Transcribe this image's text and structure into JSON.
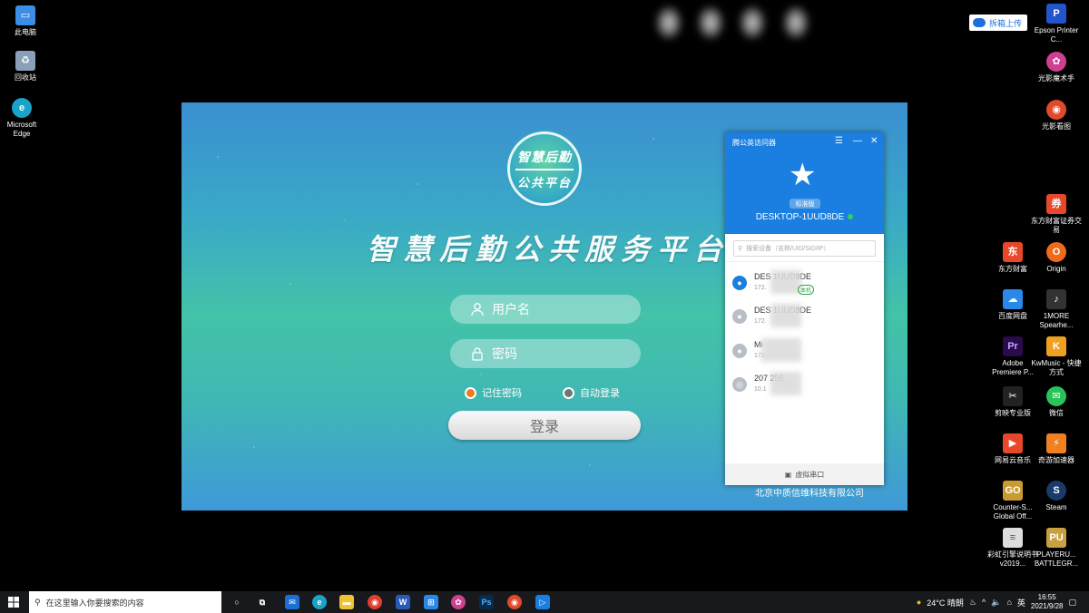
{
  "desktop_left": [
    {
      "label": "此电脑",
      "icon": "computer-icon",
      "color": "#3a8ee6"
    },
    {
      "label": "回收站",
      "icon": "recycle-bin-icon",
      "color": "#8aa0b8"
    },
    {
      "label": "Microsoft Edge",
      "icon": "edge-icon",
      "color": "#19a3c8"
    }
  ],
  "desktop_right": [
    {
      "label": "Epson Printer C...",
      "icon": "printer-icon",
      "color": "#2255cc"
    },
    {
      "label": "光影魔术手",
      "icon": "photo-editor-icon",
      "color": "#d04090"
    },
    {
      "label": "光影看图",
      "icon": "image-viewer-icon",
      "color": "#e04a2a"
    },
    {
      "label": "东方财富证券交易",
      "icon": "stock-trading-icon",
      "color": "#e8482a"
    },
    {
      "label": "东方财富",
      "icon": "eastmoney-icon",
      "color": "#e8482a"
    },
    {
      "label": "Origin",
      "icon": "origin-icon",
      "color": "#f06a1a"
    },
    {
      "label": "百度网盘",
      "icon": "baidu-netdisk-icon",
      "color": "#2a88e8"
    },
    {
      "label": "1MORE Spearhe...",
      "icon": "headphone-icon",
      "color": "#333333"
    },
    {
      "label": "Adobe Premiere P...",
      "icon": "premiere-icon",
      "color": "#2a0a4a"
    },
    {
      "label": "KwMusic - 快捷方式",
      "icon": "kwmusic-icon",
      "color": "#f0a020"
    },
    {
      "label": "剪映专业版",
      "icon": "jianying-icon",
      "color": "#222222"
    },
    {
      "label": "微信",
      "icon": "wechat-icon",
      "color": "#2ac35a"
    },
    {
      "label": "网易云音乐",
      "icon": "netease-music-icon",
      "color": "#e8482a"
    },
    {
      "label": "奇游加速器",
      "icon": "accelerator-icon",
      "color": "#f08020"
    },
    {
      "label": "Counter-S... Global Off...",
      "icon": "csgo-icon",
      "color": "#c89a30"
    },
    {
      "label": "Steam",
      "icon": "steam-icon",
      "color": "#1a3a6a"
    },
    {
      "label": "彩虹引擎说明书 v2019...",
      "icon": "document-icon",
      "color": "#dddddd"
    },
    {
      "label": "PLAYERU... BATTLEGR...",
      "icon": "pubg-icon",
      "color": "#c8a040"
    }
  ],
  "sync_badge": {
    "label": "拆箱上传"
  },
  "login": {
    "logo_line1": "智慧后勤",
    "logo_line2": "公共平台",
    "title": "智慧后勤公共服务平台",
    "username_placeholder": "用户名",
    "password_placeholder": "密码",
    "remember_label": "记住密码",
    "autologin_label": "自动登录",
    "login_button": "登录",
    "company": "北京中质信维科技有限公司"
  },
  "remote": {
    "title": "腾公英访问器",
    "badge": "标准版",
    "device": "DESKTOP-1UUD8DE",
    "search_placeholder": "搜索设备（名称/UID/SID/IP）",
    "footer": "虚拟串口",
    "items": [
      {
        "name": "DES       1UUD8DE",
        "ip": "172.",
        "tag": "本机",
        "avatar_color": "#1a7fe0"
      },
      {
        "name": "DES       1UUD8DE",
        "ip": "172.",
        "tag": "",
        "avatar_color": "#b9bec6"
      },
      {
        "name": "Mi",
        "ip": "172.",
        "tag": "",
        "avatar_color": "#b9bec6"
      },
      {
        "name": "207          255",
        "ip": "10.1",
        "tag": "",
        "avatar_color": "#b9bec6"
      }
    ]
  },
  "taskbar": {
    "search_placeholder": "在这里输入你要搜索的内容",
    "weather": "24°C 晴朗",
    "ime": "英",
    "time": "16:55",
    "date": "2021/9/28"
  }
}
